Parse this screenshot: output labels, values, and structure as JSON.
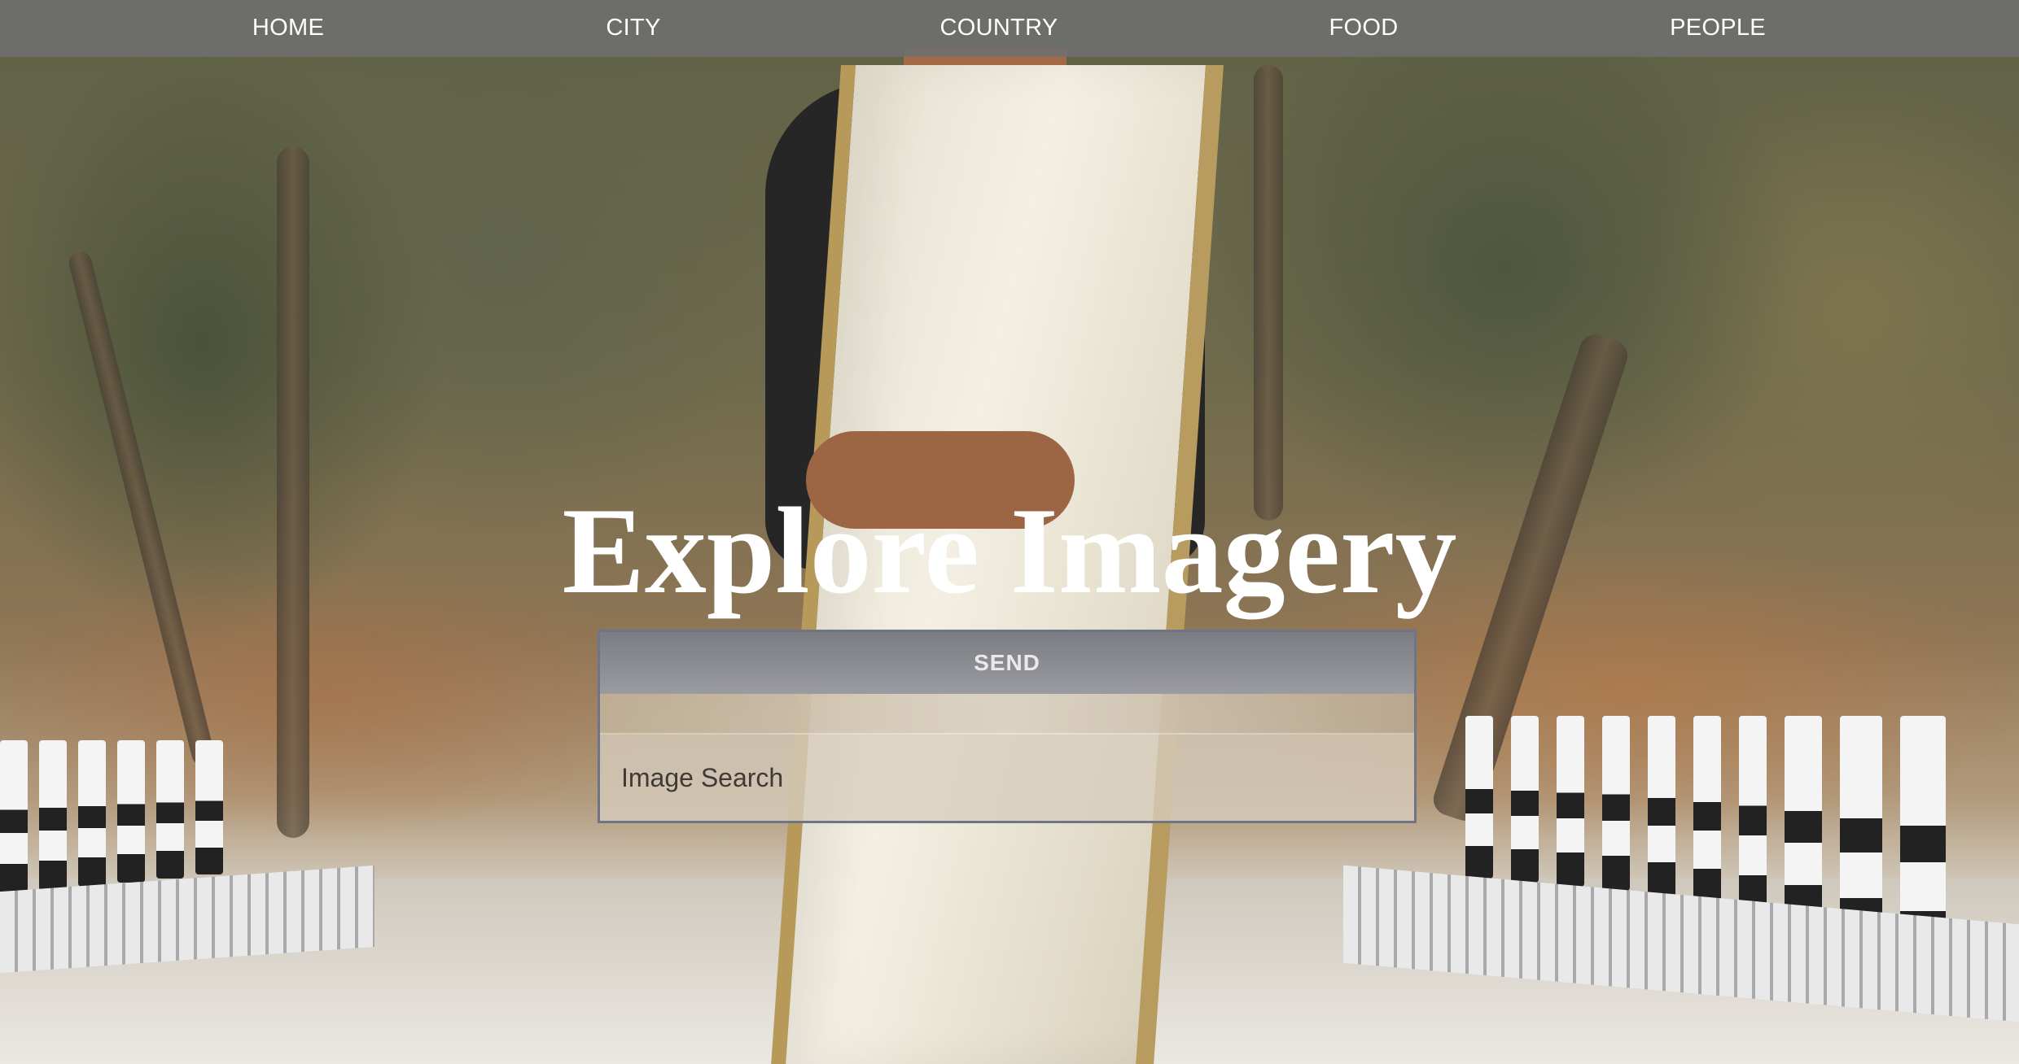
{
  "nav": {
    "items": [
      {
        "label": "HOME"
      },
      {
        "label": "CITY"
      },
      {
        "label": "COUNTRY"
      },
      {
        "label": "FOOD"
      },
      {
        "label": "PEOPLE"
      }
    ]
  },
  "hero": {
    "title": "Explore Imagery"
  },
  "search": {
    "button_label": "SEND",
    "placeholder": "Image Search",
    "value": ""
  },
  "colors": {
    "nav_background": "#6e6e6e",
    "nav_text": "#ffffff",
    "title_text": "#ffffff",
    "button_background": "#8a8b90",
    "panel_border": "#6f7585"
  },
  "background": {
    "subject": "person in cream saree with black blouse on a road bridge lined with trees"
  }
}
